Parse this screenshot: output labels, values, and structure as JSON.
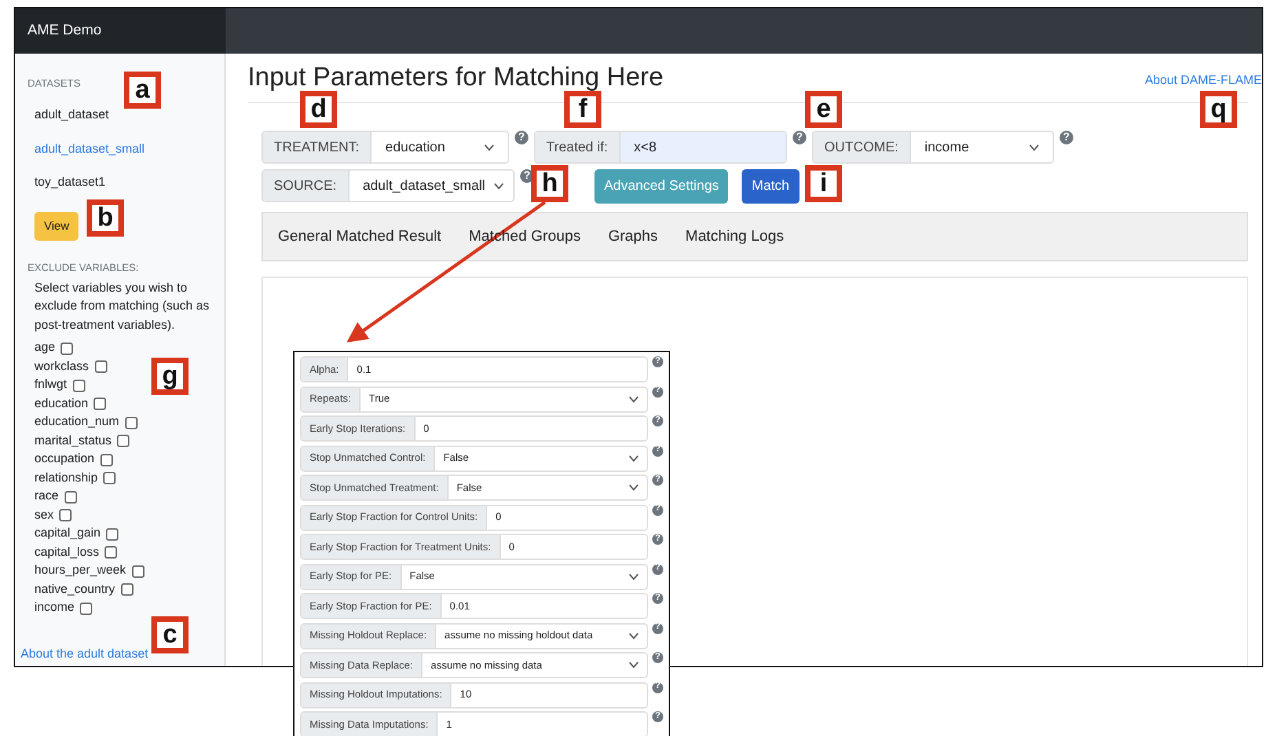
{
  "navbar": {
    "brand": "AME Demo"
  },
  "sidebar": {
    "datasets_heading": "DATASETS",
    "datasets": [
      {
        "label": "adult_dataset",
        "selected": false
      },
      {
        "label": "adult_dataset_small",
        "selected": true
      },
      {
        "label": "toy_dataset1",
        "selected": false
      }
    ],
    "view_button": "View",
    "exclude_heading": "EXCLUDE VARIABLES:",
    "exclude_help": "Select variables you wish to exclude from matching (such as post-treatment variables).",
    "variables": [
      {
        "label": "age",
        "checked": false
      },
      {
        "label": "workclass",
        "checked": false
      },
      {
        "label": "fnlwgt",
        "checked": false
      },
      {
        "label": "education",
        "checked": false
      },
      {
        "label": "education_num",
        "checked": false
      },
      {
        "label": "marital_status",
        "checked": false
      },
      {
        "label": "occupation",
        "checked": false
      },
      {
        "label": "relationship",
        "checked": false
      },
      {
        "label": "race",
        "checked": false
      },
      {
        "label": "sex",
        "checked": false
      },
      {
        "label": "capital_gain",
        "checked": false
      },
      {
        "label": "capital_loss",
        "checked": false
      },
      {
        "label": "hours_per_week",
        "checked": false
      },
      {
        "label": "native_country",
        "checked": false
      },
      {
        "label": "income",
        "checked": false
      }
    ],
    "footer_link": "About the adult dataset"
  },
  "main": {
    "title": "Input Parameters for Matching Here",
    "about_link": "About DAME-FLAME",
    "fields": [
      {
        "kind": "select",
        "label": "TREATMENT:",
        "value": "education",
        "help": "?"
      },
      {
        "kind": "input",
        "label": "Treated if:",
        "value": "x<8",
        "help": "?"
      },
      {
        "kind": "select",
        "label": "OUTCOME:",
        "value": "income",
        "help": "?"
      }
    ],
    "source": {
      "kind": "select",
      "label": "SOURCE:",
      "value": "adult_dataset_small",
      "help": "?"
    },
    "buttons": [
      {
        "kind": "info",
        "label": "Advanced Settings"
      },
      {
        "kind": "primary",
        "label": "Match"
      }
    ],
    "tabs": [
      {
        "label": "General Matched Result"
      },
      {
        "label": "Matched Groups"
      },
      {
        "label": "Graphs"
      },
      {
        "label": "Matching Logs"
      }
    ]
  },
  "advanced_settings": [
    {
      "kind": "input",
      "label": "Alpha:",
      "value": "0.1",
      "help": "?"
    },
    {
      "kind": "select",
      "label": "Repeats:",
      "value": "True",
      "help": "?"
    },
    {
      "kind": "input",
      "label": "Early Stop Iterations:",
      "value": "0",
      "help": "?"
    },
    {
      "kind": "select",
      "label": "Stop Unmatched Control:",
      "value": "False",
      "help": "?"
    },
    {
      "kind": "select",
      "label": "Stop Unmatched Treatment:",
      "value": "False",
      "help": "?"
    },
    {
      "kind": "input",
      "label": "Early Stop Fraction for Control Units:",
      "value": "0",
      "help": "?"
    },
    {
      "kind": "input",
      "label": "Early Stop Fraction for Treatment Units:",
      "value": "0",
      "help": "?"
    },
    {
      "kind": "select",
      "label": "Early Stop for PE:",
      "value": "False",
      "help": "?"
    },
    {
      "kind": "input",
      "label": "Early Stop Fraction for PE:",
      "value": "0.01",
      "help": "?"
    },
    {
      "kind": "select",
      "label": "Missing Holdout Replace:",
      "value": "assume no missing holdout data",
      "help": "?"
    },
    {
      "kind": "select",
      "label": "Missing Data Replace:",
      "value": "assume no missing data",
      "help": "?"
    },
    {
      "kind": "input",
      "label": "Missing Holdout Imputations:",
      "value": "10",
      "help": "?"
    },
    {
      "kind": "input",
      "label": "Missing Data Imputations:",
      "value": "1",
      "help": "?"
    }
  ],
  "callouts": [
    {
      "label": "a"
    },
    {
      "label": "d"
    },
    {
      "label": "f"
    },
    {
      "label": "e"
    },
    {
      "label": "q"
    },
    {
      "label": "h"
    },
    {
      "label": "i"
    },
    {
      "label": "b"
    },
    {
      "label": "g"
    },
    {
      "label": "c"
    }
  ]
}
